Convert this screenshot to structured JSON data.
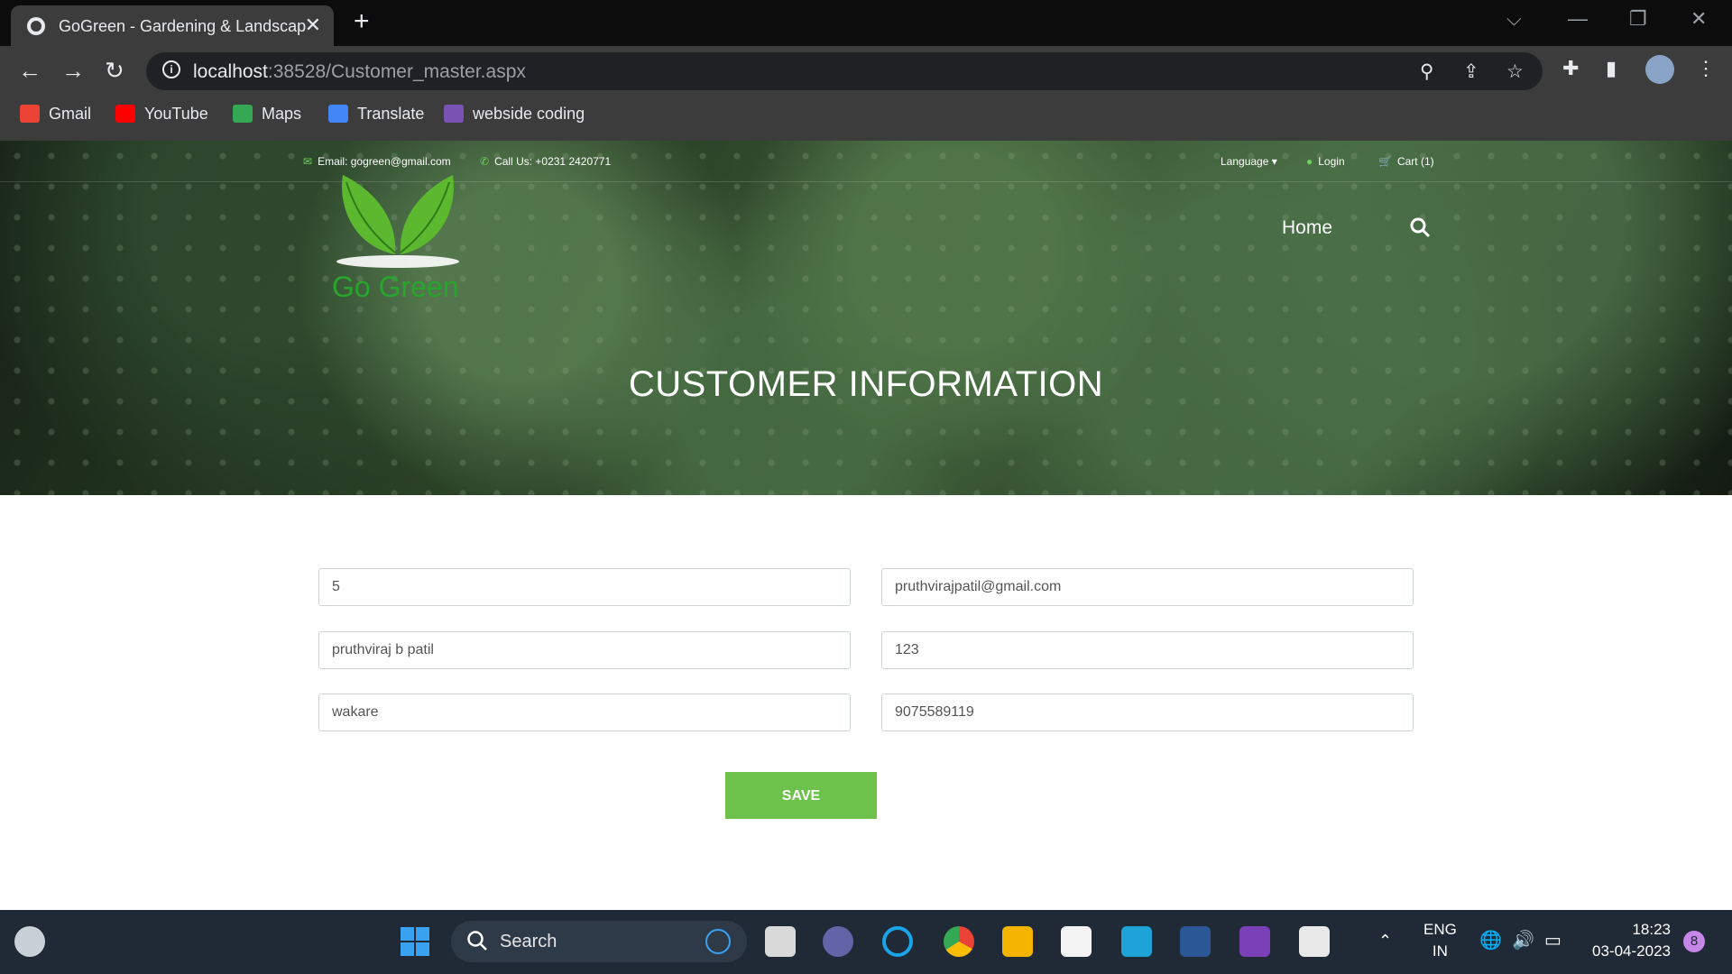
{
  "browser": {
    "tab_title": "GoGreen - Gardening & Landscap",
    "url_host": "localhost",
    "url_path": ":38528/Customer_master.aspx",
    "bookmarks": [
      "Gmail",
      "YouTube",
      "Maps",
      "Translate",
      "webside coding"
    ]
  },
  "site": {
    "email": "Email: gogreen@gmail.com",
    "phone": "Call Us: +0231 2420771",
    "language": "Language",
    "login": "Login",
    "cart": "Cart (1)",
    "logo_text": "Go Green",
    "nav_home": "Home",
    "hero_title": "CUSTOMER INFORMATION"
  },
  "form": {
    "customer_id": "5",
    "email": "pruthvirajpatil@gmail.com",
    "name": "pruthviraj b patil",
    "password": "123",
    "address": "wakare",
    "phone": "9075589119",
    "save_label": "SAVE"
  },
  "taskbar": {
    "search": "Search",
    "lang_top": "ENG",
    "lang_bottom": "IN",
    "time": "18:23",
    "date": "03-04-2023",
    "notification_count": "8"
  }
}
